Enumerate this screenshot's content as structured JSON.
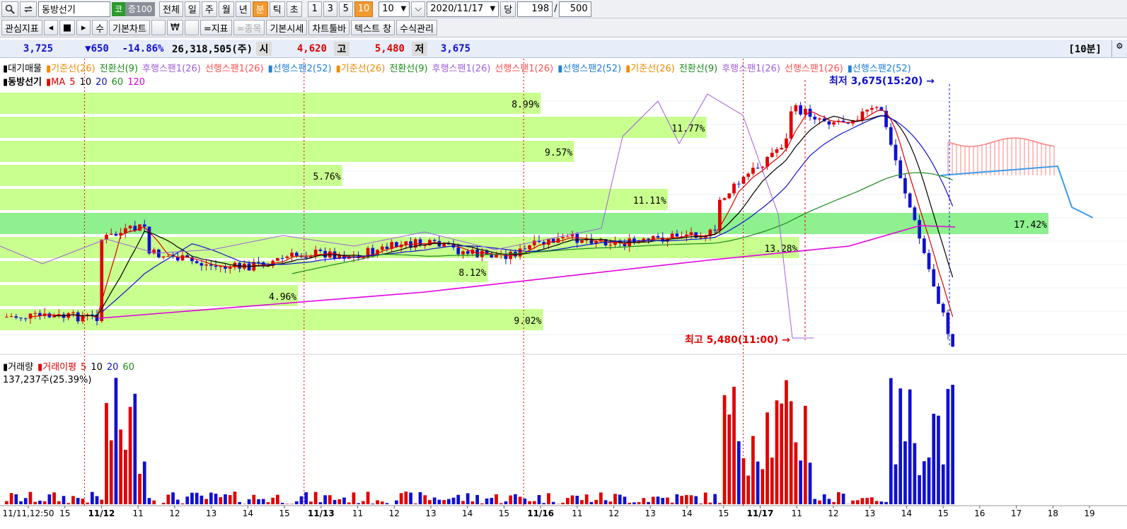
{
  "toolbar1": {
    "stock_name": "동방선기",
    "market_badge": "코",
    "group_badge": "증100",
    "period_buttons": [
      "전체",
      "일",
      "주",
      "월",
      "년",
      "분",
      "틱",
      "초"
    ],
    "active_period": "분",
    "interval_buttons": [
      "1",
      "3",
      "5",
      "10"
    ],
    "active_interval": "10",
    "interval_select": "10",
    "date": "2020/11/17",
    "count_label": "당",
    "count_value": "198",
    "count_sep": "/",
    "count_total": "500"
  },
  "toolbar2": {
    "buttons": [
      "관심지표",
      "◂",
      "■",
      "▸",
      "수",
      "기본차트",
      " ",
      "₩",
      " ",
      "=지표",
      "=종목",
      "기본시세",
      "차트툴바",
      "텍스트 창",
      "수식관리"
    ]
  },
  "quote": {
    "price": "3,725",
    "change": "▼650",
    "rate": "-14.86%",
    "volume": "26,318,505(주)",
    "open_label": "시",
    "open": "4,620",
    "high_label": "고",
    "high": "5,480",
    "low_label": "저",
    "low": "3,675",
    "interval_tag": "[10분]"
  },
  "legend": {
    "row1": [
      {
        "text": "▮대기매물",
        "color": "#000000"
      },
      {
        "text": "▮기준선(26)",
        "color": "#f08a00"
      },
      {
        "text": "전환선(9)",
        "color": "#1a8a1a"
      },
      {
        "text": "후행스팬1(26)",
        "color": "#a060d8"
      },
      {
        "text": "선행스팬1(26)",
        "color": "#ff5050"
      },
      {
        "text": "▮선행스팬2(52)",
        "color": "#1e7fd8"
      },
      {
        "text": "▮기준선(26)",
        "color": "#f08a00"
      },
      {
        "text": "전환선(9)",
        "color": "#1a8a1a"
      },
      {
        "text": "후행스팬1(26)",
        "color": "#a060d8"
      },
      {
        "text": "선행스팬1(26)",
        "color": "#ff5050"
      },
      {
        "text": "▮선행스팬2(52)",
        "color": "#1e7fd8"
      },
      {
        "text": "▮기준선(26)",
        "color": "#f08a00"
      },
      {
        "text": "전환선(9)",
        "color": "#1a8a1a"
      },
      {
        "text": "후행스팬1(26)",
        "color": "#a060d8"
      },
      {
        "text": "선행스팬1(26)",
        "color": "#ff5050"
      },
      {
        "text": "▮선행스팬2(52)",
        "color": "#1e7fd8"
      }
    ],
    "row2_name": "▮동방선기",
    "row2_ma": [
      {
        "text": "▮MA",
        "color": "#e00000"
      },
      {
        "text": "5",
        "color": "#e00000"
      },
      {
        "text": "10",
        "color": "#000000"
      },
      {
        "text": "20",
        "color": "#1010d0"
      },
      {
        "text": "60",
        "color": "#1a8a1a"
      },
      {
        "text": "120",
        "color": "#e000e0"
      }
    ],
    "vol_row": [
      {
        "text": "▮거래량",
        "color": "#000000"
      },
      {
        "text": "▮거래이평",
        "color": "#e00000"
      },
      {
        "text": "5",
        "color": "#e00000"
      },
      {
        "text": "10",
        "color": "#000000"
      },
      {
        "text": "20",
        "color": "#1010d0"
      },
      {
        "text": "60",
        "color": "#1a8a1a"
      }
    ],
    "vol_value": "137,237주(25.39%)"
  },
  "chart_data": {
    "type": "candlestick",
    "interval": "10분",
    "x_labels": [
      "11/11,12:50",
      "15",
      "11/12",
      "11",
      "12",
      "13",
      "14",
      "15",
      "11/13",
      "11",
      "12",
      "13",
      "14",
      "15",
      "11/16",
      "11",
      "12",
      "13",
      "14",
      "15",
      "11/17",
      "11",
      "12",
      "13",
      "14",
      "15",
      "16",
      "17",
      "18",
      "19"
    ],
    "x_label_bold": [
      "11/12",
      "11/13",
      "11/16",
      "11/17"
    ],
    "volume_profile": [
      {
        "percent": "8.99%",
        "width_frac": 0.49
      },
      {
        "percent": "11.77%",
        "width_frac": 0.64
      },
      {
        "percent": "9.57%",
        "width_frac": 0.52
      },
      {
        "percent": "5.76%",
        "width_frac": 0.31
      },
      {
        "percent": "11.11%",
        "width_frac": 0.605
      },
      {
        "percent": "17.42%",
        "width_frac": 0.95
      },
      {
        "percent": "13.28%",
        "width_frac": 0.724
      },
      {
        "percent": "8.12%",
        "width_frac": 0.442
      },
      {
        "percent": "4.96%",
        "width_frac": 0.27
      },
      {
        "percent": "9.02%",
        "width_frac": 0.492
      }
    ],
    "high_marker": "최고 5,480(11:00)",
    "low_marker": "최저 3,675(15:20)",
    "colors": {
      "up": "#e00000",
      "down": "#1010d0",
      "profile": "#c8ff8e",
      "profile_hi": "#8ef08e",
      "cloud": "#ff8080",
      "cloud_border": "#3d9be8"
    }
  }
}
